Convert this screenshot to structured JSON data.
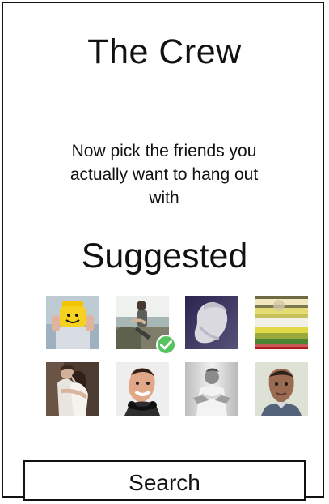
{
  "header": {
    "title": "The Crew"
  },
  "intro": {
    "text": "Now pick the friends you actually want to hang out with"
  },
  "suggested": {
    "title": "Suggested",
    "friends": [
      {
        "avatar": "lego-mask-avatar",
        "selected": false
      },
      {
        "avatar": "person-by-river-avatar",
        "selected": true
      },
      {
        "avatar": "person-profile-avatar",
        "selected": false
      },
      {
        "avatar": "striped-glitch-avatar",
        "selected": false
      },
      {
        "avatar": "couple-hug-avatar",
        "selected": false
      },
      {
        "avatar": "smiling-man-headphones-avatar",
        "selected": false
      },
      {
        "avatar": "man-pointing-avatar",
        "selected": false
      },
      {
        "avatar": "man-portrait-avatar",
        "selected": false
      }
    ]
  },
  "actions": {
    "search_label": "Search"
  },
  "colors": {
    "check": "#56c35f",
    "border": "#111111"
  }
}
